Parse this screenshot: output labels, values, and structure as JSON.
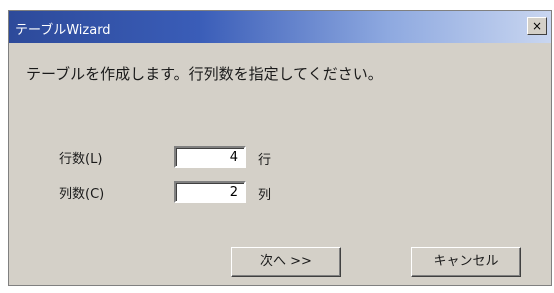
{
  "window": {
    "title": "テーブルWizard",
    "close_label": "×"
  },
  "instruction": "テーブルを作成します。行列数を指定してください。",
  "rows": {
    "label": "行数(L)",
    "value": "4",
    "unit": "行"
  },
  "columns": {
    "label": "列数(C)",
    "value": "2",
    "unit": "列"
  },
  "buttons": {
    "next": "次へ >>",
    "cancel": "キャンセル"
  }
}
